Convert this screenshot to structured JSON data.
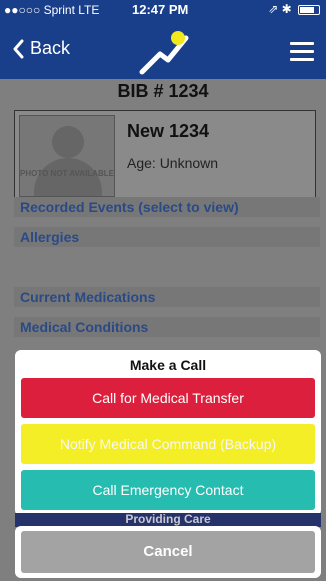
{
  "status_bar": {
    "carrier": "●●○○○ Sprint  LTE",
    "time": "12:47 PM",
    "right": "⇗ ✱"
  },
  "nav": {
    "back_label": "Back"
  },
  "patient": {
    "bib": "BIB # 1234",
    "name": "New 1234",
    "age": "Age: Unknown",
    "photo_placeholder": "PHOTO NOT AVAILABLE"
  },
  "sections": [
    "Recorded Events (select to view)",
    "Allergies",
    "Current Medications",
    "Medical Conditions"
  ],
  "action_sheet": {
    "title": "Make a Call",
    "actions": [
      {
        "label": "Call for Medical Transfer",
        "color": "#dc1f3c"
      },
      {
        "label": "Notify Medical Command (Backup)",
        "color": "#f4ee27"
      },
      {
        "label": "Call Emergency Contact",
        "color": "#26bcb0"
      }
    ],
    "behind_label": "Providing Care",
    "cancel_label": "Cancel"
  },
  "colors": {
    "nav": "#1a3f8a",
    "section_text": "#2a4a86",
    "cancel": "#a3a3a3"
  }
}
